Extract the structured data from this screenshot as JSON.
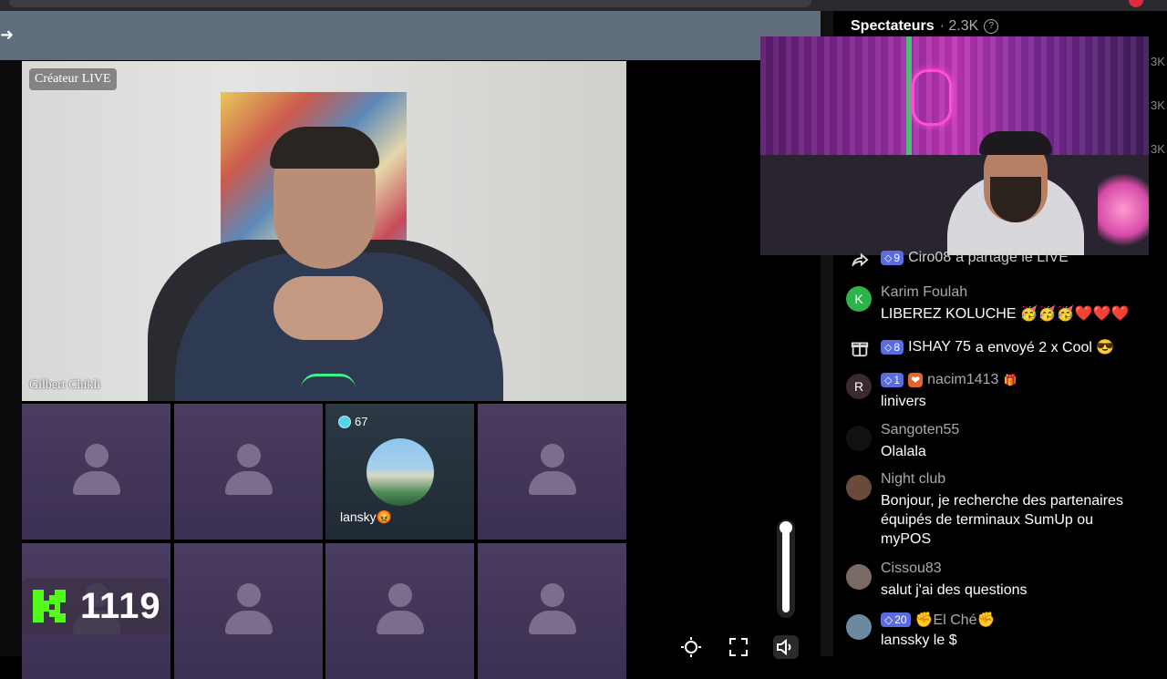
{
  "nav": {
    "back_glyph": "➜"
  },
  "host": {
    "badge": "Créateur LIVE",
    "name": "Gilbert Chikli"
  },
  "grid": {
    "guest": {
      "score": "67",
      "name": "lansky😡"
    }
  },
  "kick": {
    "count": "1119",
    "brand_color": "#53fc18"
  },
  "panel": {
    "viewers_title": "Spectateurs",
    "viewers_count": "· 2.3K",
    "help_glyph": "?",
    "side_labels": [
      "3K",
      "3K",
      "3K"
    ]
  },
  "chat": [
    {
      "type": "share",
      "icon": "share-icon",
      "level": "9",
      "user": "Ciro08",
      "text": "a partagé le LIVE"
    },
    {
      "type": "message",
      "avatar_letter": "K",
      "avatar_color": "#2db34a",
      "user": "Karim Foulah",
      "text": "LIBEREZ KOLUCHE 🥳🥳🥳❤️❤️❤️"
    },
    {
      "type": "gift",
      "icon": "gift-icon",
      "level": "8",
      "user": "ISHAY 75",
      "text": "a envoyé 2 x Cool 😎"
    },
    {
      "type": "message",
      "avatar_letter": "R",
      "avatar_color": "#3a2a2e",
      "level": "1",
      "heart": "❤",
      "user": "nacim1413",
      "text": "linivers"
    },
    {
      "type": "message",
      "avatar_letter": "",
      "avatar_color": "#111111",
      "user": "Sangoten55",
      "text": "Olalala"
    },
    {
      "type": "message",
      "avatar_letter": "",
      "avatar_color": "#6a4a3a",
      "user": "Night club",
      "text": "Bonjour, je recherche des partenaires équipés de terminaux SumUp ou myPOS"
    },
    {
      "type": "message",
      "avatar_letter": "",
      "avatar_color": "#7a6a64",
      "user": "Cissou83",
      "text": "salut j'ai des questions"
    },
    {
      "type": "message",
      "avatar_letter": "",
      "avatar_color": "#6b8aa0",
      "level": "20",
      "user": "✊El Ché✊",
      "text": "lanssky le $"
    }
  ],
  "controls": {
    "brightness": "brightness-icon",
    "fullscreen": "fullscreen-icon",
    "volume": "volume-icon"
  }
}
